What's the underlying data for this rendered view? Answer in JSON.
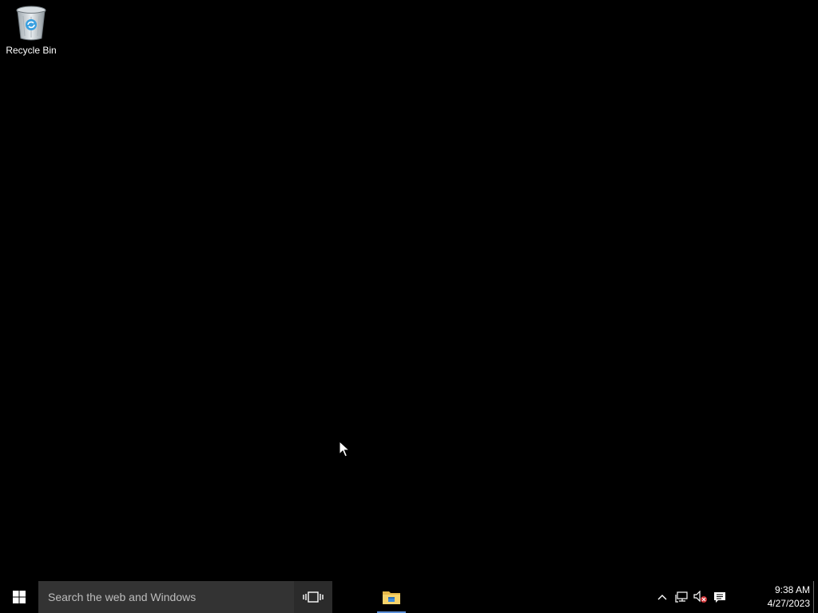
{
  "desktop": {
    "icons": [
      {
        "label": "Recycle Bin",
        "icon": "recycle-bin-icon"
      }
    ],
    "background_color": "#000000"
  },
  "taskbar": {
    "start": {
      "icon": "windows-logo-icon"
    },
    "search": {
      "placeholder": "Search the web and Windows"
    },
    "task_view": {
      "icon": "task-view-icon"
    },
    "pinned": [
      {
        "app": "File Explorer",
        "icon": "folder-icon",
        "running": true
      }
    ],
    "tray": {
      "icons": [
        "chevron-up-icon",
        "network-icon",
        "volume-muted-icon",
        "action-center-icon"
      ]
    },
    "clock": {
      "time": "9:38 AM",
      "date": "4/27/2023"
    }
  }
}
